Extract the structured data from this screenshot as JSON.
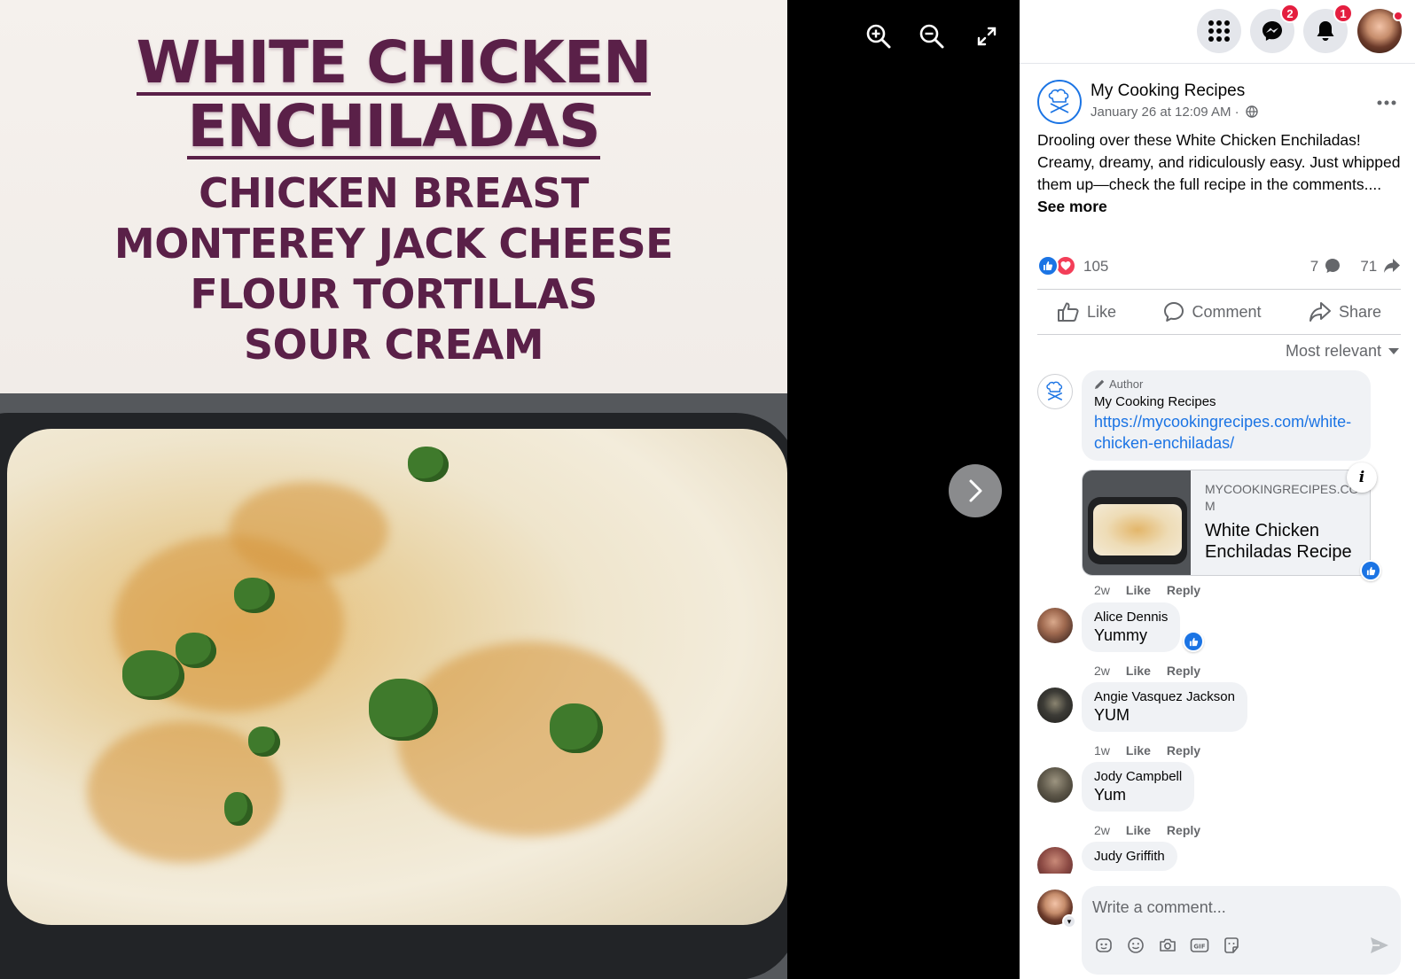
{
  "viewer": {
    "image_title": [
      "WHITE CHICKEN",
      "ENCHILADAS"
    ],
    "ingredients": [
      "CHICKEN BREAST",
      "MONTEREY JACK CHEESE",
      "FLOUR TORTILLAS",
      "SOUR CREAM"
    ],
    "controls": {
      "zoom_in": "zoom-in-icon",
      "zoom_out": "zoom-out-icon",
      "fullscreen": "fullscreen-icon",
      "next": "chevron-right-icon"
    }
  },
  "topbar": {
    "menu_icon": "grid-menu-icon",
    "messenger_badge": "2",
    "notifications_badge": "1"
  },
  "post": {
    "page_name": "My Cooking Recipes",
    "date": "January 26 at 12:09 AM ·",
    "privacy_icon": "globe-icon",
    "text": "Drooling over these White Chicken Enchiladas! Creamy, dreamy, and ridiculously easy. Just whipped them up—check the full recipe in the comments.... ",
    "see_more": "See more",
    "reactions_count": "105",
    "comments_count": "7",
    "shares_count": "71",
    "actions": {
      "like": "Like",
      "comment": "Comment",
      "share": "Share"
    },
    "sort_label": "Most relevant"
  },
  "comments": [
    {
      "badge": "Author",
      "name": "My Cooking Recipes",
      "link": "https://mycookingrecipes.com/white-chicken-enchiladas/",
      "preview": {
        "domain": "MYCOOKINGRECIPES.COM",
        "title": "White Chicken Enchiladas Recipe"
      },
      "time": "2w",
      "like": "Like",
      "reply": "Reply"
    },
    {
      "name": "Alice Dennis",
      "text": "Yummy",
      "time": "2w",
      "like": "Like",
      "reply": "Reply"
    },
    {
      "name": "Angie Vasquez Jackson",
      "text": "YUM",
      "time": "1w",
      "like": "Like",
      "reply": "Reply"
    },
    {
      "name": "Jody Campbell",
      "text": "Yum",
      "time": "2w",
      "like": "Like",
      "reply": "Reply"
    },
    {
      "name": "Judy Griffith"
    }
  ],
  "composer": {
    "placeholder": "Write a comment..."
  },
  "colors": {
    "facebook_blue": "#1b74e4",
    "title_plum": "#5a2048",
    "badge_red": "#e41e3f"
  }
}
